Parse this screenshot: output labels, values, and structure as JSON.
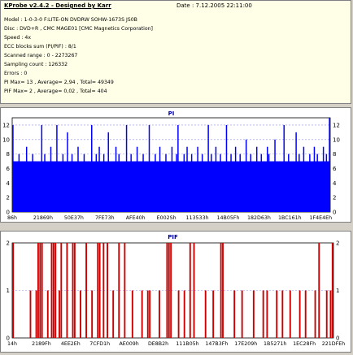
{
  "header": {
    "title": "KProbe v2.4.2 - Designed by Karr",
    "date": "Date : 7.12.2005 22:11:00"
  },
  "info": {
    "model": "Model : 1-0-3-0 F:LITE-ON DVDRW SOHW-1673S JS0B",
    "disc": "Disc : DVD+R , CMC MAGE01 [CMC Magnetics Corporation]",
    "speed": "Speed : 4x",
    "ecc": "ECC blocks sum (PI/PIF) : 8/1",
    "scanned": "Scanned range : 0 - 2273267",
    "sampling": "Sampling count : 126332",
    "errors": "Errors : 0",
    "pi_stats": "PI Max= 13 , Average= 2,94 , Total= 49349",
    "pif_stats": "PIF Max= 2 , Average= 0,02 , Total= 404"
  },
  "colors": {
    "pi_bar": "#0000ff",
    "pif_bar": "#cc0000",
    "grid": "#9090ff",
    "panel_bg": "#ffffff",
    "info_bg": "#ffffe7"
  },
  "chart_data": [
    {
      "type": "bar",
      "title": "PI",
      "ylim": [
        0,
        13
      ],
      "yticks": [
        0,
        2,
        4,
        6,
        8,
        10,
        12
      ],
      "xtick_labels": [
        "86h",
        "21869h",
        "50E37h",
        "7FE73h",
        "AFE40h",
        "E002Sh",
        "113533h",
        "14B05Fh",
        "182D63h",
        "1BC161h",
        "1F4E4Eh"
      ],
      "grid": true,
      "baseline_level": 7,
      "values": [
        12,
        7,
        6,
        7,
        8,
        6,
        7,
        5,
        7,
        9,
        6,
        7,
        6,
        8,
        5,
        7,
        6,
        7,
        6,
        12,
        6,
        8,
        7,
        5,
        6,
        9,
        7,
        6,
        7,
        12,
        6,
        7,
        5,
        8,
        6,
        7,
        11,
        6,
        7,
        8,
        5,
        6,
        7,
        9,
        6,
        7,
        6,
        8,
        7,
        5,
        7,
        6,
        12,
        7,
        6,
        8,
        5,
        9,
        6,
        7,
        8,
        6,
        7,
        11,
        6,
        5,
        7,
        6,
        9,
        7,
        8,
        6,
        5,
        7,
        6,
        12,
        6,
        7,
        8,
        6,
        5,
        7,
        9,
        6,
        7,
        5,
        8,
        6,
        7,
        6,
        12,
        7,
        5,
        6,
        8,
        7,
        6,
        9,
        5,
        7,
        6,
        8,
        7,
        6,
        5,
        9,
        7,
        6,
        8,
        12,
        7,
        6,
        5,
        8,
        6,
        9,
        7,
        6,
        8,
        7,
        5,
        6,
        9,
        6,
        7,
        8,
        5,
        7,
        6,
        12,
        7,
        8,
        6,
        5,
        9,
        7,
        6,
        8,
        6,
        7,
        5,
        12,
        6,
        7,
        8,
        6,
        5,
        9,
        7,
        6,
        8,
        7,
        5,
        6,
        10,
        7,
        6,
        8,
        5,
        7,
        6,
        9,
        7,
        6,
        8,
        5,
        7,
        6,
        9,
        8,
        5,
        6,
        7,
        10,
        5,
        6,
        7,
        6,
        5,
        12,
        7,
        6,
        8,
        5,
        6,
        7,
        6,
        11,
        5,
        8,
        7,
        6,
        9,
        5,
        7,
        6,
        8,
        6,
        5,
        9,
        7,
        8,
        6,
        5,
        7,
        9,
        6,
        8,
        7,
        13
      ]
    },
    {
      "type": "bar",
      "title": "PIF",
      "ylim": [
        0,
        2
      ],
      "yticks": [
        0,
        1,
        2
      ],
      "xtick_labels": [
        "14h",
        "2189Fh",
        "4EE2Eh",
        "7CFD1h",
        "AE009h",
        "DE8B2h",
        "111B05h",
        "147B3Fh",
        "17E209h",
        "1B5271h",
        "1EC28Fh",
        "221DFEh"
      ],
      "grid": true,
      "values": [
        2,
        0,
        0,
        0,
        0,
        0,
        0,
        0,
        0,
        1,
        0,
        0,
        1,
        2,
        2,
        2,
        0,
        0,
        1,
        0,
        2,
        2,
        2,
        0,
        1,
        2,
        0,
        0,
        2,
        0,
        0,
        2,
        2,
        0,
        0,
        1,
        0,
        0,
        2,
        0,
        0,
        1,
        0,
        0,
        2,
        2,
        0,
        2,
        0,
        2,
        0,
        0,
        1,
        0,
        0,
        2,
        0,
        0,
        2,
        0,
        0,
        0,
        1,
        0,
        0,
        0,
        0,
        1,
        0,
        0,
        1,
        1,
        0,
        0,
        0,
        0,
        1,
        0,
        0,
        0,
        2,
        2,
        2,
        0,
        0,
        0,
        1,
        0,
        0,
        1,
        0,
        0,
        2,
        0,
        2,
        0,
        0,
        0,
        0,
        0,
        1,
        0,
        0,
        0,
        1,
        0,
        0,
        0,
        2,
        2,
        0,
        0,
        0,
        0,
        0,
        1,
        0,
        0,
        0,
        1,
        0,
        0,
        0,
        0,
        0,
        1,
        0,
        0,
        0,
        0,
        1,
        0,
        1,
        0,
        0,
        0,
        0,
        1,
        0,
        0,
        1,
        0,
        0,
        0,
        1,
        0,
        0,
        0,
        0,
        1,
        0,
        0,
        1,
        0,
        0,
        0,
        0,
        1,
        0,
        2,
        0,
        0,
        0,
        1,
        0,
        1,
        2
      ]
    }
  ]
}
